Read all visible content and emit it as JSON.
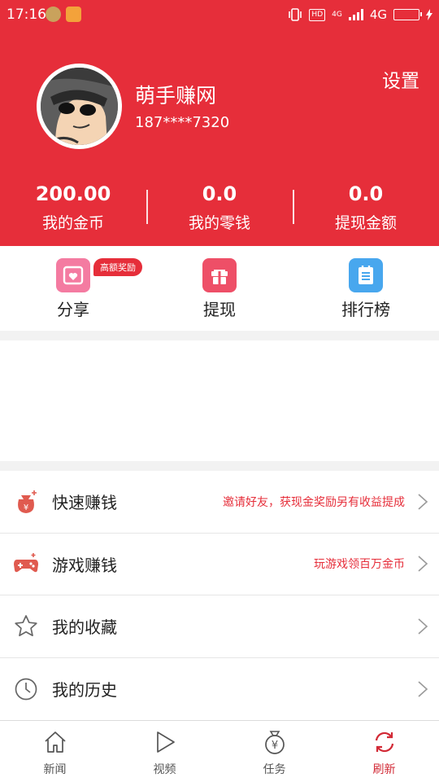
{
  "status_bar": {
    "time": "17:16",
    "hd": "HD",
    "network_small": "4G",
    "network": "4G",
    "battery_level": 0.85
  },
  "profile": {
    "name": "萌手赚网",
    "phone": "187****7320",
    "settings_label": "设置"
  },
  "stats": [
    {
      "value": "200.00",
      "label": "我的金币"
    },
    {
      "value": "0.0",
      "label": "我的零钱"
    },
    {
      "value": "0.0",
      "label": "提现金额"
    }
  ],
  "quick_actions": [
    {
      "label": "分享",
      "icon": "share-heart-icon",
      "badge": "高额奖励"
    },
    {
      "label": "提现",
      "icon": "gift-icon"
    },
    {
      "label": "排行榜",
      "icon": "clipboard-list-icon"
    }
  ],
  "menu": [
    {
      "title": "快速赚钱",
      "hint": "邀请好友，获现金奖励另有收益提成",
      "icon": "money-bag-icon"
    },
    {
      "title": "游戏赚钱",
      "hint": "玩游戏领百万金币",
      "icon": "gamepad-icon"
    },
    {
      "title": "我的收藏",
      "hint": "",
      "icon": "star-icon"
    },
    {
      "title": "我的历史",
      "hint": "",
      "icon": "clock-icon"
    }
  ],
  "tabs": [
    {
      "label": "新闻",
      "icon": "home-icon",
      "active": false
    },
    {
      "label": "视频",
      "icon": "play-icon",
      "active": false
    },
    {
      "label": "任务",
      "icon": "yuan-bag-icon",
      "active": false
    },
    {
      "label": "刷新",
      "icon": "refresh-icon",
      "active": true
    }
  ],
  "colors": {
    "brand_red": "#e62e3a",
    "active_tab": "#d22a36"
  }
}
